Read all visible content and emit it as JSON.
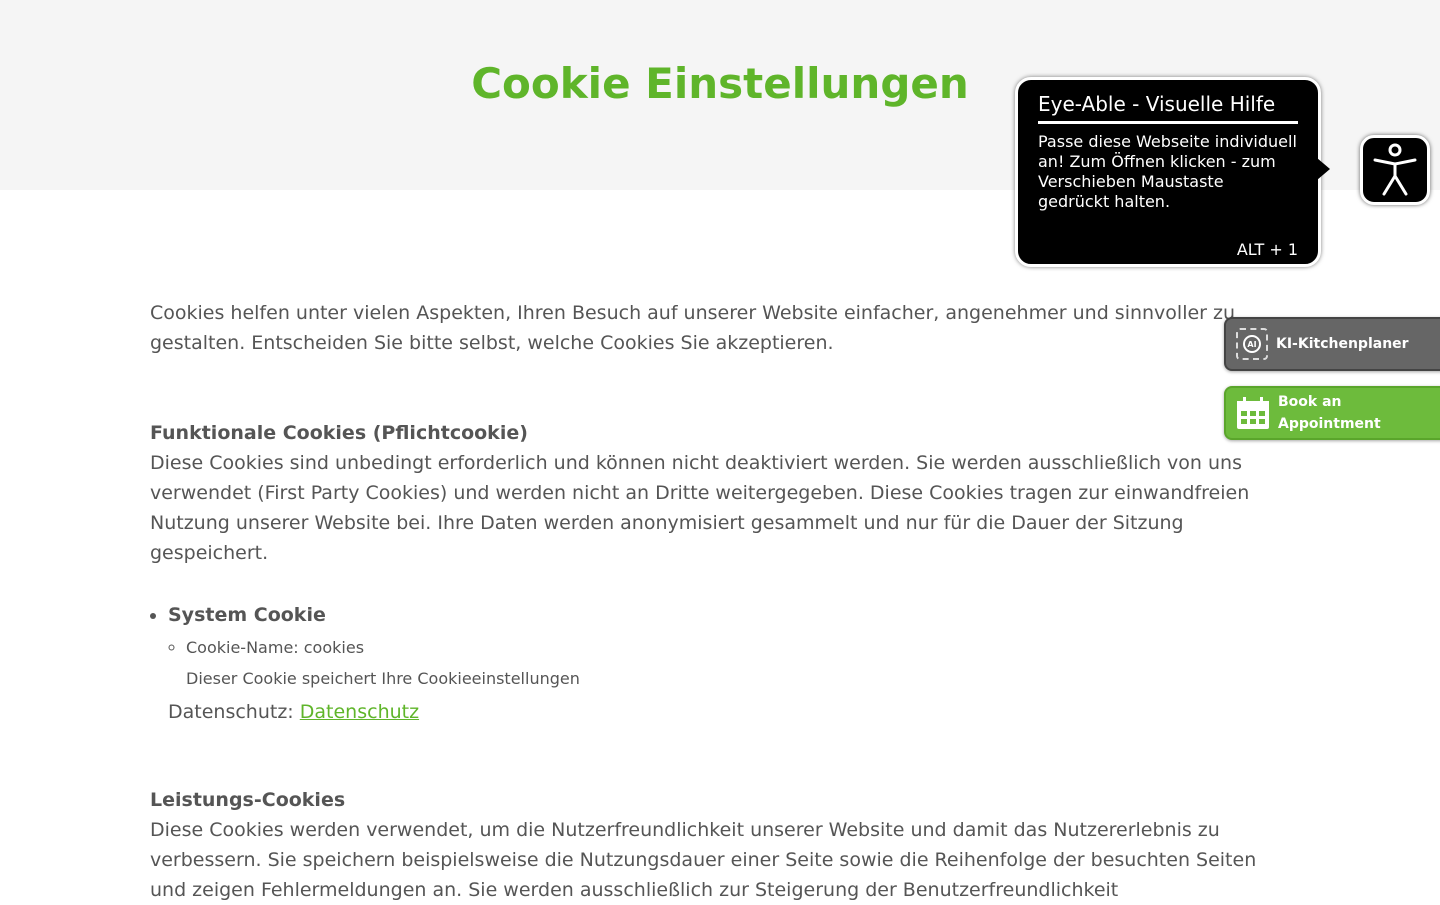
{
  "header": {
    "title": "Cookie Einstellungen"
  },
  "intro": "Cookies helfen unter vielen Aspekten, Ihren Besuch auf unserer Website einfacher, angenehmer und sinnvoller zu gestalten. Entscheiden Sie bitte selbst, welche Cookies Sie akzeptieren.",
  "functional": {
    "heading": "Funktionale Cookies (Pflichtcookie)",
    "text": "Diese Cookies sind unbedingt erforderlich und können nicht deaktiviert werden. Sie werden ausschließlich von uns verwendet (First Party Cookies) und werden nicht an Dritte weitergegeben. Diese Cookies tragen zur einwandfreien Nutzung unserer Website bei. Ihre Daten werden anonymisiert gesammelt und nur für die Dauer der Sitzung gespeichert.",
    "cookie": {
      "name": "System Cookie",
      "cookie_name": "Cookie-Name: cookies",
      "description": "Dieser Cookie speichert Ihre Cookieeinstellungen",
      "privacy_label": "Datenschutz:",
      "privacy_link": "Datenschutz"
    }
  },
  "performance": {
    "heading": "Leistungs-Cookies",
    "text": "Diese Cookies werden verwendet, um die Nutzerfreundlichkeit unserer Website und damit das Nutzererlebnis zu verbessern. Sie speichern beispielsweise die Nutzungsdauer einer Seite sowie die Reihenfolge der besuchten Seiten und zeigen Fehlermeldungen an. Sie werden ausschließlich zur Steigerung der Benutzerfreundlichkeit"
  },
  "eye_able": {
    "title": "Eye-Able - Visuelle Hilfe",
    "body": "Passe diese Webseite individuell an! Zum Öffnen klicken - zum Verschieben Maustaste gedrückt halten.",
    "shortcut": "ALT + 1"
  },
  "side_buttons": {
    "kitchen_label": "KI-Kitchenplaner",
    "kitchen_icon_text": "AI",
    "book_label_line1": "Book an",
    "book_label_line2": "Appointment"
  },
  "colors": {
    "accent": "#5fb52a",
    "text": "#555555",
    "header_bg": "#f5f5f5"
  }
}
